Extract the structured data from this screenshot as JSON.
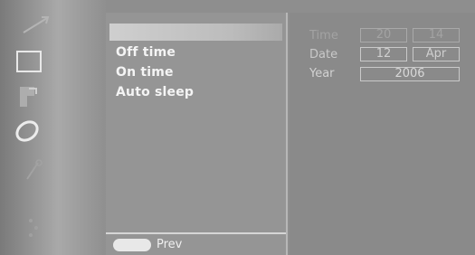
{
  "menu": {
    "items": [
      {
        "label": ""
      },
      {
        "label": "Off time"
      },
      {
        "label": "On time"
      },
      {
        "label": "Auto sleep"
      }
    ],
    "prev_label": "Prev"
  },
  "settings": {
    "time_label": "Time",
    "date_label": "Date",
    "year_label": "Year",
    "hour": "20",
    "minute": "14",
    "day": "12",
    "month": "Apr",
    "year": "2006"
  },
  "icons": [
    "arrow-icon",
    "picture-icon",
    "figure-icon",
    "ring-icon",
    "key-icon",
    "dots-icon"
  ]
}
